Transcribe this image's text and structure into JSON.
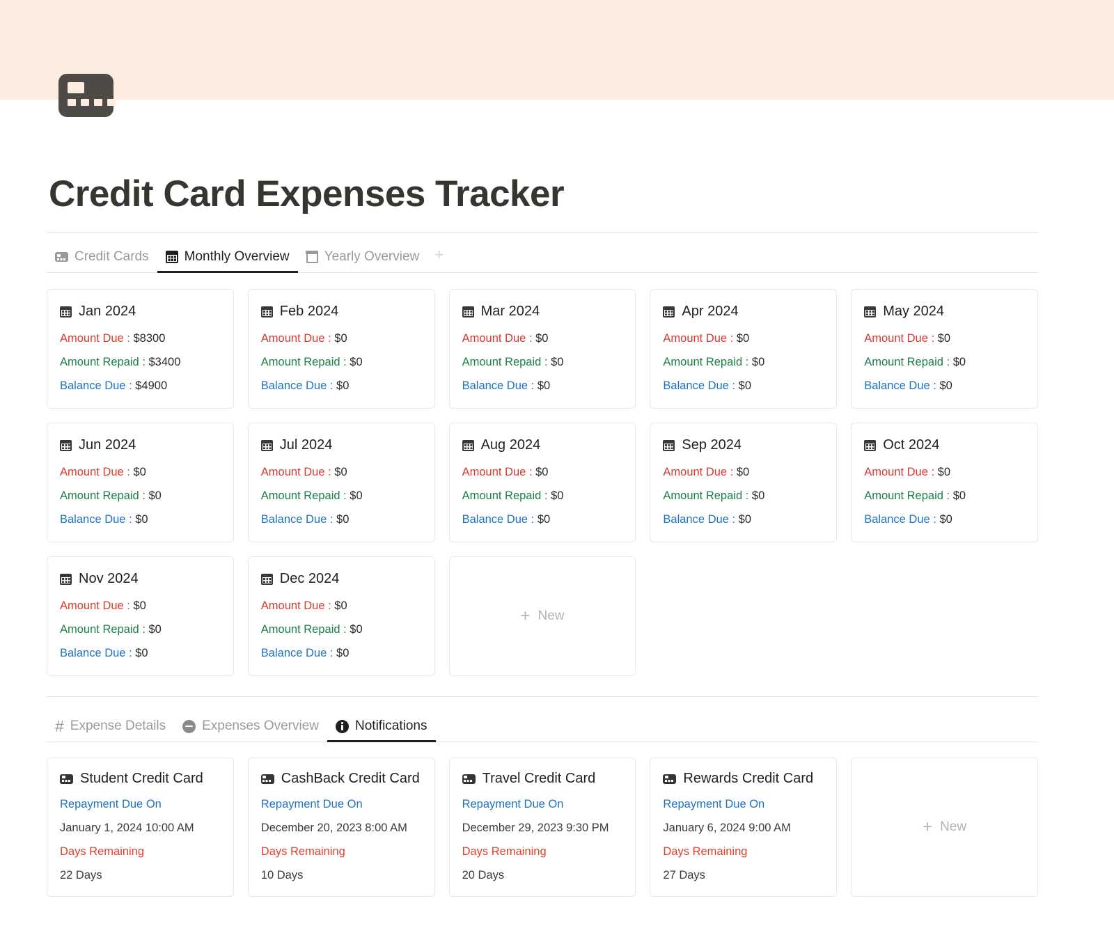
{
  "header": {
    "icon": "credit-card-icon",
    "title": "Credit Card Expenses Tracker",
    "banner_color": "#fdece0"
  },
  "top_tabs": {
    "items": [
      {
        "label": "Credit Cards",
        "icon": "credit-card-icon",
        "active": false
      },
      {
        "label": "Monthly Overview",
        "icon": "calendar-grid-icon",
        "active": true
      },
      {
        "label": "Yearly Overview",
        "icon": "calendar-blank-icon",
        "active": false
      }
    ],
    "add_label": "+"
  },
  "months": {
    "new_label": "New",
    "labels": {
      "amount_due": "Amount Due :",
      "amount_repaid": "Amount Repaid :",
      "balance_due": "Balance Due :"
    },
    "cards": [
      {
        "title": "Jan 2024",
        "amount_due": "$8300",
        "amount_repaid": "$3400",
        "balance_due": "$4900"
      },
      {
        "title": "Feb 2024",
        "amount_due": "$0",
        "amount_repaid": "$0",
        "balance_due": "$0"
      },
      {
        "title": "Mar 2024",
        "amount_due": "$0",
        "amount_repaid": "$0",
        "balance_due": "$0"
      },
      {
        "title": "Apr 2024",
        "amount_due": "$0",
        "amount_repaid": "$0",
        "balance_due": "$0"
      },
      {
        "title": "May 2024",
        "amount_due": "$0",
        "amount_repaid": "$0",
        "balance_due": "$0"
      },
      {
        "title": "Jun 2024",
        "amount_due": "$0",
        "amount_repaid": "$0",
        "balance_due": "$0"
      },
      {
        "title": "Jul 2024",
        "amount_due": "$0",
        "amount_repaid": "$0",
        "balance_due": "$0"
      },
      {
        "title": "Aug 2024",
        "amount_due": "$0",
        "amount_repaid": "$0",
        "balance_due": "$0"
      },
      {
        "title": "Sep 2024",
        "amount_due": "$0",
        "amount_repaid": "$0",
        "balance_due": "$0"
      },
      {
        "title": "Oct 2024",
        "amount_due": "$0",
        "amount_repaid": "$0",
        "balance_due": "$0"
      },
      {
        "title": "Nov 2024",
        "amount_due": "$0",
        "amount_repaid": "$0",
        "balance_due": "$0"
      },
      {
        "title": "Dec 2024",
        "amount_due": "$0",
        "amount_repaid": "$0",
        "balance_due": "$0"
      }
    ]
  },
  "bottom_tabs": {
    "items": [
      {
        "label": "Expense Details",
        "icon": "hash-icon",
        "active": false
      },
      {
        "label": "Expenses Overview",
        "icon": "minus-circle-icon",
        "active": false
      },
      {
        "label": "Notifications",
        "icon": "info-circle-icon",
        "active": true
      }
    ]
  },
  "notifications": {
    "new_label": "New",
    "labels": {
      "repayment_due_on": "Repayment Due On",
      "days_remaining": "Days Remaining"
    },
    "cards": [
      {
        "title": "Student Credit Card",
        "due_date": "January 1, 2024 10:00 AM",
        "days": "22 Days"
      },
      {
        "title": "CashBack Credit Card",
        "due_date": "December 20, 2023 8:00 AM",
        "days": "10 Days"
      },
      {
        "title": "Travel Credit Card",
        "due_date": "December 29, 2023 9:30 PM",
        "days": "20 Days"
      },
      {
        "title": "Rewards Credit Card",
        "due_date": "January 6, 2024 9:00 AM",
        "days": "27 Days"
      }
    ]
  },
  "colors": {
    "due": "#d63b2f",
    "repaid": "#1b7f4a",
    "balance": "#1f72c4",
    "accent_banner": "#fdece0"
  }
}
